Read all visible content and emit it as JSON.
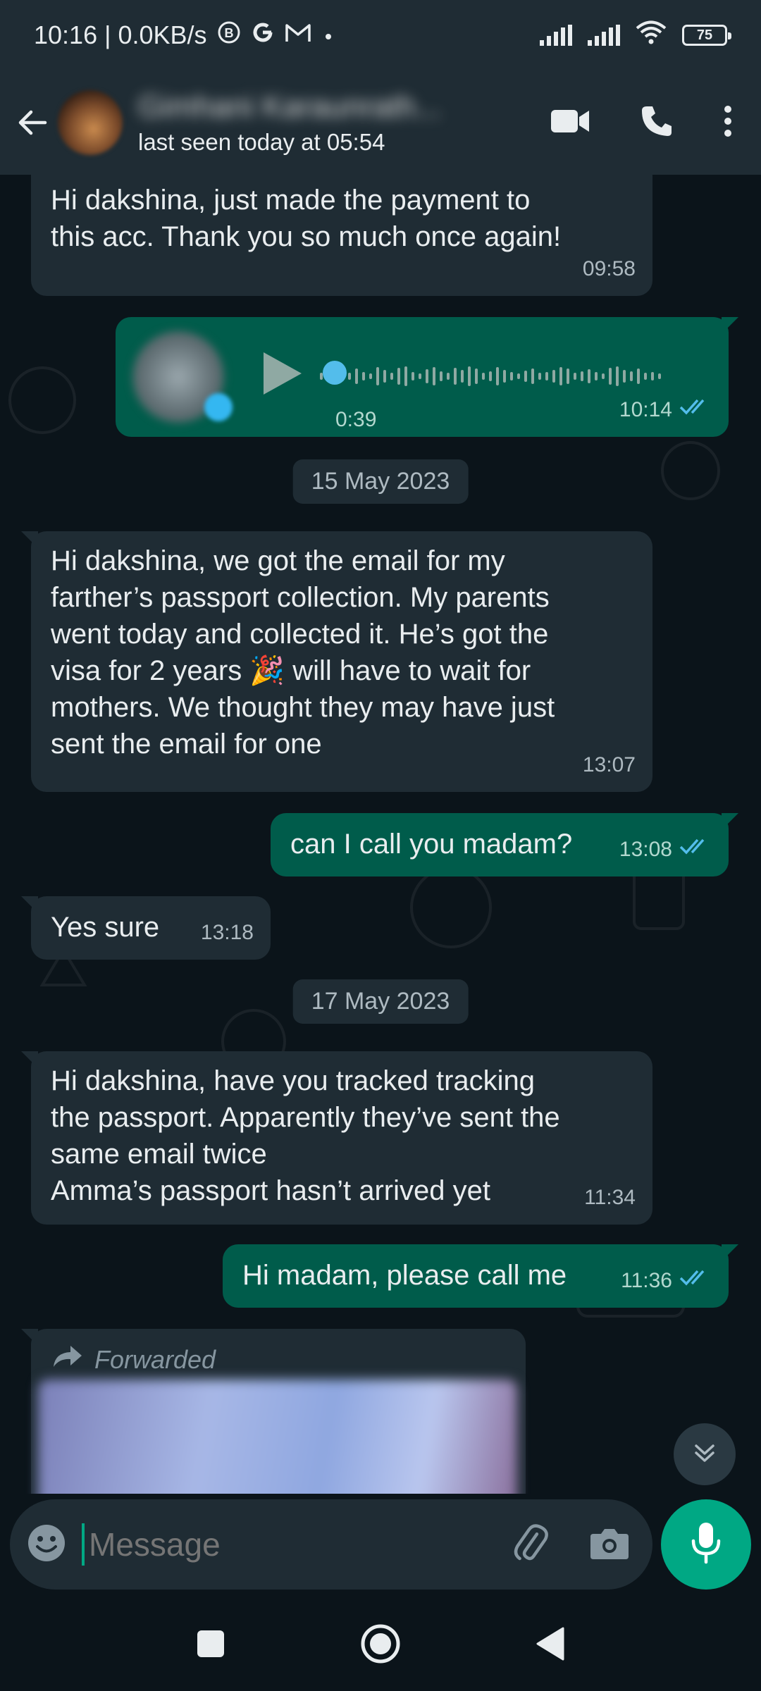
{
  "status_bar": {
    "time_speed": "10:16 | 0.0KB/s",
    "battery": "75"
  },
  "header": {
    "contact_name": "Gimhani Karaunrath...",
    "last_seen": "last seen today at 05:54"
  },
  "messages": [
    {
      "type": "in",
      "text": "Hi dakshina, just made the payment to\nthis acc. Thank you so much once again!",
      "time": "09:58"
    },
    {
      "type": "voice",
      "duration": "0:39",
      "time": "10:14"
    },
    {
      "type": "date",
      "text": "15 May 2023"
    },
    {
      "type": "in",
      "text": "Hi dakshina, we got the email for my\nfarther’s passport collection. My parents\nwent today and collected it. He’s got the\nvisa for 2 years 🎉 will have to wait for\nmothers. We thought they may have just\nsent the email for one",
      "time": "13:07"
    },
    {
      "type": "out",
      "text": "can I call you madam?",
      "time": "13:08"
    },
    {
      "type": "in",
      "text": "Yes sure",
      "time": "13:18"
    },
    {
      "type": "date",
      "text": "17 May 2023"
    },
    {
      "type": "in",
      "text": "Hi dakshina, have you tracked tracking\nthe passport. Apparently they’ve sent the\nsame email twice\nAmma’s passport hasn’t arrived yet",
      "time": "11:34"
    },
    {
      "type": "out",
      "text": "Hi madam, please call me",
      "time": "11:36"
    },
    {
      "type": "forwarded",
      "label": "Forwarded"
    }
  ],
  "input": {
    "placeholder": "Message"
  },
  "colors": {
    "background": "#0b141a",
    "incoming_bubble": "#1f2c34",
    "outgoing_bubble": "#005c4b",
    "accent": "#00a884",
    "read_ticks": "#53bdeb"
  },
  "icons": [
    "back-arrow-icon",
    "video-call-icon",
    "voice-call-icon",
    "more-options-icon",
    "play-icon",
    "double-check-icon",
    "forward-icon",
    "chevron-down-icon",
    "emoji-icon",
    "attach-icon",
    "camera-icon",
    "mic-icon",
    "nav-recents-icon",
    "nav-home-icon",
    "nav-back-icon"
  ]
}
